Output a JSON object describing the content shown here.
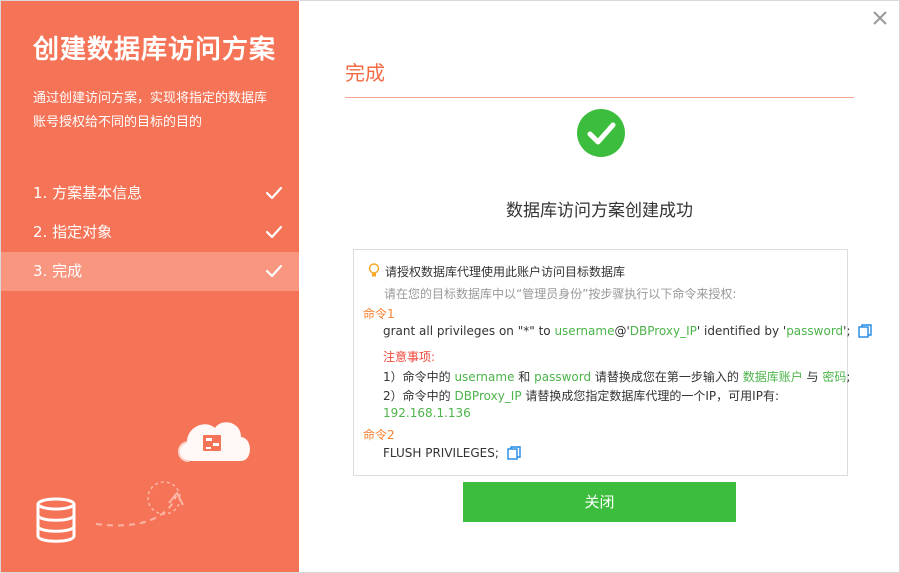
{
  "sidebar": {
    "title": "创建数据库访问方案",
    "description": "通过创建访问方案，实现将指定的数据库账号授权给不同的目标的目的",
    "steps": [
      {
        "label": "1. 方案基本信息",
        "done": true
      },
      {
        "label": "2. 指定对象",
        "done": true
      },
      {
        "label": "3. 完成",
        "done": true,
        "active": true
      }
    ]
  },
  "main": {
    "heading": "完成",
    "success_message": "数据库访问方案创建成功",
    "info": {
      "tip": "请授权数据库代理使用此账户访问目标数据库",
      "instruction": "请在您的目标数据库中以“管理员身份”按步骤执行以下命令来授权:",
      "command1_label": "命令1",
      "command1": {
        "p1": "grant all privileges on \"*\" to ",
        "username": "username",
        "at": "@'",
        "ip": "DBProxy_IP",
        "p2": "' identified by '",
        "password": "password",
        "p3": "';"
      },
      "notes_label": "注意事项:",
      "note1": {
        "p1": "1）命令中的 ",
        "username": "username",
        "p2": " 和 ",
        "password": "password",
        "p3": " 请替换成您在第一步输入的 ",
        "account": "数据库账户",
        "p4": " 与 ",
        "pwd": "密码",
        "p5": ";"
      },
      "note2": {
        "p1": "2）命令中的 ",
        "ip": "DBProxy_IP",
        "p2": " 请替换成您指定数据库代理的一个IP，可用IP有:"
      },
      "available_ip": "192.168.1.136",
      "command2_label": "命令2",
      "command2": "FLUSH PRIVILEGES;"
    },
    "close_button": "关闭"
  },
  "colors": {
    "sidebar_bg": "#f57356",
    "active_step_bg": "#f89680",
    "accent": "#f56a45",
    "success_green": "#3dbd3d",
    "highlight_green": "#4cb44a",
    "command_label_orange": "#f5802f",
    "notes_red": "#f04a3a",
    "copy_icon_blue": "#1e88e5"
  },
  "icons": [
    "check-icon",
    "close-icon",
    "success-check-icon",
    "lightbulb-icon",
    "copy-icon",
    "cloud-icon",
    "database-icon"
  ]
}
